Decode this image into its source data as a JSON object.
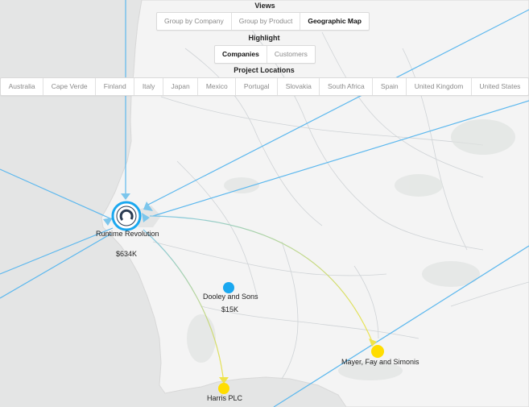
{
  "views": {
    "heading": "Views",
    "options": [
      "Group by Company",
      "Group by Product",
      "Geographic Map"
    ],
    "active": "Geographic Map"
  },
  "highlight": {
    "heading": "Highlight",
    "options": [
      "Companies",
      "Customers"
    ],
    "active": "Companies"
  },
  "project_locations": {
    "heading": "Project Locations",
    "options": [
      "Australia",
      "Cape Verde",
      "Finland",
      "Italy",
      "Japan",
      "Mexico",
      "Portugal",
      "Slovakia",
      "South Africa",
      "Spain",
      "United Kingdom",
      "United States"
    ]
  },
  "map": {
    "companies": [
      {
        "name": "Runtime Revolution",
        "value": "$634K",
        "marker": "company-logo"
      },
      {
        "name": "Dooley and Sons",
        "value": "$15K",
        "marker": "blue-dot"
      },
      {
        "name": "Mayer, Fay and Simonis",
        "value": "",
        "marker": "yellow-dot"
      },
      {
        "name": "Harris PLC",
        "value": "",
        "marker": "yellow-dot"
      }
    ],
    "colors": {
      "company_dot": "#1aa8f0",
      "customer_dot": "#ffdd00",
      "flow_line": "#5db8ee",
      "land": "#f4f4f4",
      "sea": "#e4e5e5"
    }
  }
}
